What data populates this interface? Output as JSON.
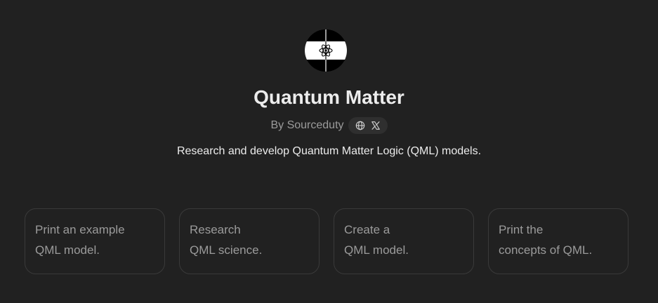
{
  "gpt": {
    "logo_icon": "atom-icon",
    "title": "Quantum Matter",
    "author": "By Sourceduty",
    "social_links": [
      {
        "icon": "globe-icon"
      },
      {
        "icon": "x-logo-icon"
      }
    ],
    "description": "Research and develop Quantum Matter Logic (QML) models."
  },
  "conversation_starters": [
    {
      "text": "Print an example\nQML model."
    },
    {
      "text": "Research\nQML science."
    },
    {
      "text": "Create a\nQML model."
    },
    {
      "text": "Print the\nconcepts of QML."
    }
  ],
  "colors": {
    "background": "#212121",
    "title": "#ececec",
    "muted_text": "#9b9b9b",
    "card_border": "#3a3a3a",
    "pill_background": "#2f2f2f"
  }
}
